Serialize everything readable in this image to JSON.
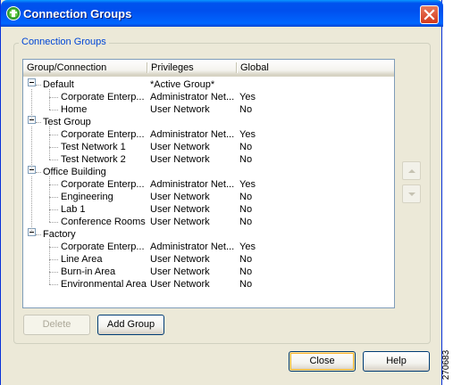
{
  "window": {
    "title": "Connection Groups"
  },
  "group_box": {
    "legend": "Connection Groups"
  },
  "list": {
    "columns": [
      "Group/Connection",
      "Privileges",
      "Global"
    ],
    "rows": [
      {
        "name": "Default",
        "privileges": "*Active Group*",
        "global": "",
        "level": 0
      },
      {
        "name": "Corporate Enterp...",
        "privileges": "Administrator Net...",
        "global": "Yes",
        "level": 1
      },
      {
        "name": "Home",
        "privileges": "User Network",
        "global": "No",
        "level": 1
      },
      {
        "name": "Test Group",
        "privileges": "",
        "global": "",
        "level": 0
      },
      {
        "name": "Corporate Enterp...",
        "privileges": "Administrator Net...",
        "global": "Yes",
        "level": 1
      },
      {
        "name": "Test Network 1",
        "privileges": "User Network",
        "global": "No",
        "level": 1
      },
      {
        "name": "Test Network 2",
        "privileges": "User Network",
        "global": "No",
        "level": 1
      },
      {
        "name": "Office Building",
        "privileges": "",
        "global": "",
        "level": 0
      },
      {
        "name": "Corporate Enterp...",
        "privileges": "Administrator Net...",
        "global": "Yes",
        "level": 1
      },
      {
        "name": "Engineering",
        "privileges": "User Network",
        "global": "No",
        "level": 1
      },
      {
        "name": "Lab 1",
        "privileges": "User Network",
        "global": "No",
        "level": 1
      },
      {
        "name": "Conference Rooms",
        "privileges": "User Network",
        "global": "No",
        "level": 1
      },
      {
        "name": "Factory",
        "privileges": "",
        "global": "",
        "level": 0
      },
      {
        "name": "Corporate Enterp...",
        "privileges": "Administrator Net...",
        "global": "Yes",
        "level": 1
      },
      {
        "name": "Line Area",
        "privileges": "User Network",
        "global": "No",
        "level": 1
      },
      {
        "name": "Burn-in Area",
        "privileges": "User Network",
        "global": "No",
        "level": 1
      },
      {
        "name": "Environmental Area",
        "privileges": "User Network",
        "global": "No",
        "level": 1
      }
    ]
  },
  "buttons": {
    "delete": "Delete",
    "add_group": "Add Group",
    "close": "Close",
    "help": "Help"
  },
  "figure_id": "270683"
}
